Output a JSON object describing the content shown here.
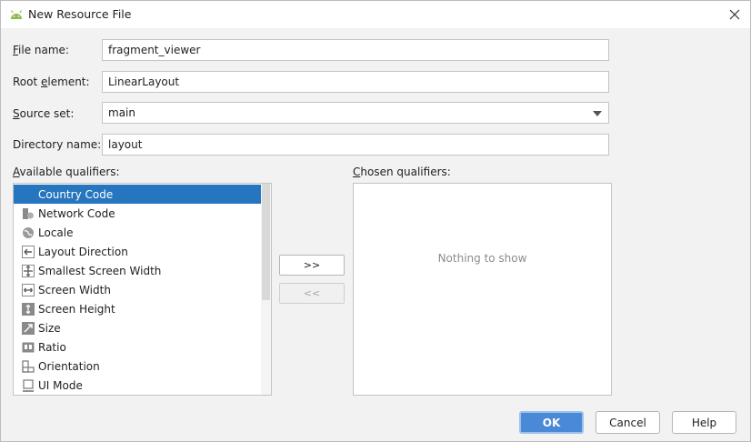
{
  "window": {
    "title": "New Resource File",
    "app_icon": "android-icon",
    "close_icon": "close-icon"
  },
  "form": {
    "file_name": {
      "label_prefix": "",
      "label_mnemonic": "F",
      "label_rest": "ile name:",
      "value": "fragment_viewer"
    },
    "root_element": {
      "label_prefix": "Root ",
      "label_mnemonic": "e",
      "label_rest": "lement:",
      "value": "LinearLayout"
    },
    "source_set": {
      "label_prefix": "",
      "label_mnemonic": "S",
      "label_rest": "ource set:",
      "value": "main"
    },
    "directory_name": {
      "label_prefix": "Directory name:",
      "label_mnemonic": "",
      "label_rest": "",
      "value": "layout"
    }
  },
  "qualifiers": {
    "available_label_mnemonic": "A",
    "available_label_rest": "vailable qualifiers:",
    "chosen_label_mnemonic": "C",
    "chosen_label_rest": "hosen qualifiers:",
    "items": [
      {
        "label": "Country Code",
        "icon": "globe-code-icon",
        "selected": true
      },
      {
        "label": "Network Code",
        "icon": "network-icon",
        "selected": false
      },
      {
        "label": "Locale",
        "icon": "globe-icon",
        "selected": false
      },
      {
        "label": "Layout Direction",
        "icon": "arrow-left-icon",
        "selected": false
      },
      {
        "label": "Smallest Screen Width",
        "icon": "expand-icon",
        "selected": false
      },
      {
        "label": "Screen Width",
        "icon": "width-arrows-icon",
        "selected": false
      },
      {
        "label": "Screen Height",
        "icon": "height-arrows-icon",
        "selected": false
      },
      {
        "label": "Size",
        "icon": "resize-icon",
        "selected": false
      },
      {
        "label": "Ratio",
        "icon": "ratio-icon",
        "selected": false
      },
      {
        "label": "Orientation",
        "icon": "orientation-icon",
        "selected": false
      },
      {
        "label": "UI Mode",
        "icon": "ui-mode-icon",
        "selected": false
      }
    ],
    "chosen_empty_text": "Nothing to show",
    "add_label": ">>",
    "remove_label": "<<"
  },
  "buttons": {
    "ok": "OK",
    "cancel": "Cancel",
    "help": "Help"
  },
  "colors": {
    "selection": "#2675bf",
    "primary_button": "#4a89d6"
  }
}
